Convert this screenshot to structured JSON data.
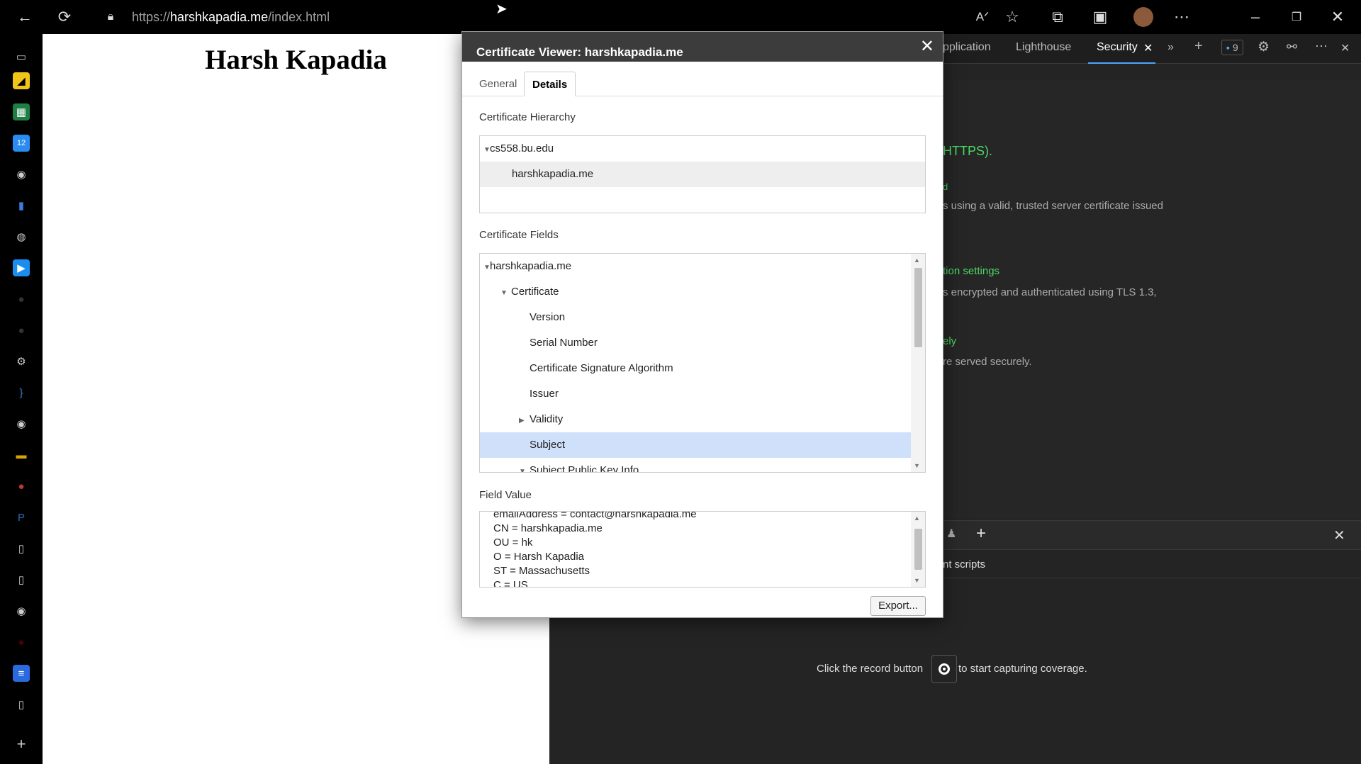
{
  "browser": {
    "url_prefix": "https://",
    "url_domain": "harshkapadia.me",
    "url_path": "/index.html",
    "icons": [
      "back-icon",
      "refresh-icon",
      "lock-icon",
      "read-aloud-icon",
      "favorites-icon",
      "extensions-icon",
      "collections-icon",
      "profile-avatar",
      "more-icon",
      "minimize-icon",
      "restore-icon",
      "close-icon"
    ]
  },
  "page": {
    "heading": "Harsh Kapadia"
  },
  "devtools": {
    "tabs": [
      "pplication",
      "Lighthouse",
      "Security"
    ],
    "issues_count": "9",
    "security": {
      "https_text": "HTTPS).",
      "valid_frag": "d",
      "cert_text": "s using a valid, trusted server certificate issued",
      "conn_title": "tion settings",
      "conn_text": "s encrypted and authenticated using TLS 1.3,",
      "res_title": "ely",
      "res_text": "re served securely."
    },
    "drawer": {
      "scripts_label": "nt scripts",
      "record_before": "Click the record button",
      "record_after": "to start capturing coverage."
    }
  },
  "dialog": {
    "title": "Certificate Viewer: harshkapadia.me",
    "tabs": {
      "general": "General",
      "details": "Details"
    },
    "hierarchy_label": "Certificate Hierarchy",
    "hierarchy": {
      "root": "cs558.bu.edu",
      "leaf": "harshkapadia.me"
    },
    "fields_label": "Certificate Fields",
    "fields": {
      "root": "harshkapadia.me",
      "cert": "Certificate",
      "version": "Version",
      "serial": "Serial Number",
      "sigalg": "Certificate Signature Algorithm",
      "issuer": "Issuer",
      "validity": "Validity",
      "subject": "Subject",
      "spki": "Subject Public Key Info"
    },
    "value_label": "Field Value",
    "value_lines": {
      "l1": "emailAddress = contact@harshkapadia.me",
      "l2": "CN = harshkapadia.me",
      "l3": "OU = hk",
      "l4": "O = Harsh Kapadia",
      "l5": "ST = Massachusetts",
      "l6": "C = US"
    },
    "export_label": "Export..."
  }
}
